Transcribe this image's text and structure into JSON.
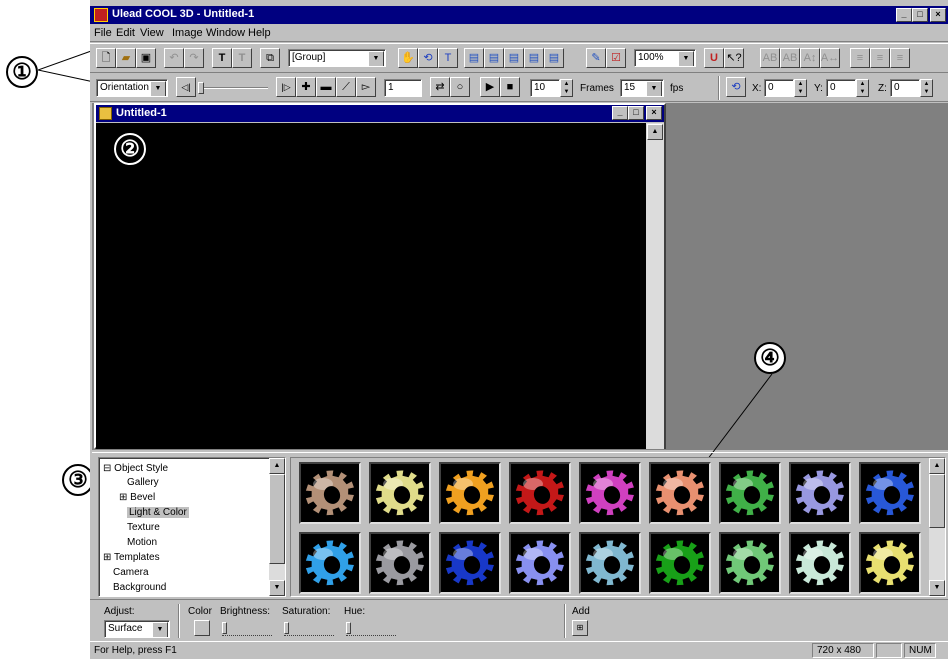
{
  "app": {
    "title": "Ulead COOL 3D - Untitled-1",
    "menu": [
      "File",
      "Edit",
      "View",
      "Image",
      "Window",
      "Help"
    ],
    "window_buttons": [
      "_",
      "□",
      "×"
    ]
  },
  "toolbar1": {
    "object_select": "[Group]",
    "zoom": "100%"
  },
  "toolbar2": {
    "mode_select": "Orientation",
    "frame_current": "1",
    "frame_count": "10",
    "frames_label": "Frames",
    "fps_value": "15",
    "fps_label": "fps",
    "x_label": "X:",
    "x_value": "0",
    "y_label": "Y:",
    "y_value": "0",
    "z_label": "Z:",
    "z_value": "0"
  },
  "document": {
    "title": "Untitled-1"
  },
  "callouts": [
    "①",
    "②",
    "③",
    "④"
  ],
  "tree": {
    "items": [
      {
        "label": "Object Style",
        "expander": "⊟"
      },
      {
        "label": "Gallery"
      },
      {
        "label": "Bevel",
        "expander": "⊞"
      },
      {
        "label": "Light & Color",
        "selected": true
      },
      {
        "label": "Texture"
      },
      {
        "label": "Motion"
      },
      {
        "label": "Templates",
        "expander": "⊞"
      },
      {
        "label": "Camera"
      },
      {
        "label": "Background"
      }
    ]
  },
  "gallery": {
    "colors_row1": [
      "#b39077",
      "#e0dc8a",
      "#f0a020",
      "#c41818",
      "#d040c0",
      "#e89070",
      "#40b048",
      "#9898e0",
      "#2858d8"
    ],
    "colors_row2": [
      "#30a0e8",
      "#9a9aa0",
      "#1838c8",
      "#8890f0",
      "#80b8d0",
      "#18a018",
      "#70c878",
      "#c8e8d8",
      "#e8e070"
    ]
  },
  "attributes": {
    "adjust_label": "Adjust:",
    "adjust_value": "Surface",
    "color_label": "Color",
    "brightness_label": "Brightness:",
    "saturation_label": "Saturation:",
    "hue_label": "Hue:",
    "add_label": "Add"
  },
  "status": {
    "help": "For Help, press F1",
    "size": "720 x 480",
    "num": "NUM"
  }
}
